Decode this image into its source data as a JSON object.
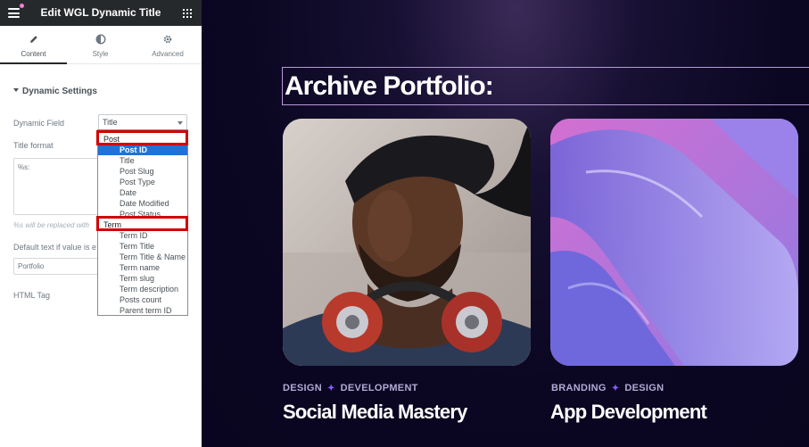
{
  "header": {
    "title": "Edit WGL Dynamic Title"
  },
  "tabs": [
    {
      "label": "Content",
      "icon": "pencil-icon",
      "active": true
    },
    {
      "label": "Style",
      "icon": "contrast-icon",
      "active": false
    },
    {
      "label": "Advanced",
      "icon": "gear-icon",
      "active": false
    }
  ],
  "section": {
    "title": "Dynamic Settings"
  },
  "controls": {
    "dynamic_field_label": "Dynamic Field",
    "dynamic_field_value": "Title",
    "title_format_label": "Title format",
    "title_format_value": "%s:",
    "hint": "%s will be replaced with",
    "default_text_label": "Default text if value is e",
    "default_text_value": "Portfolio",
    "html_tag_label": "HTML Tag"
  },
  "dropdown": {
    "groups": [
      {
        "label": "Post",
        "options": [
          "Post ID",
          "Title",
          "Post Slug",
          "Post Type",
          "Date",
          "Date Modified",
          "Post Status"
        ]
      },
      {
        "label": "Term",
        "options": [
          "Term ID",
          "Term Title",
          "Term Title & Name",
          "Term name",
          "Term slug",
          "Term description",
          "Posts count",
          "Parent term ID"
        ]
      }
    ],
    "selected": "Post ID"
  },
  "preview": {
    "heading": "Archive Portfolio:",
    "cards": [
      {
        "categories": [
          "DESIGN",
          "DEVELOPMENT"
        ],
        "title": "Social Media Mastery"
      },
      {
        "categories": [
          "BRANDING",
          "DESIGN"
        ],
        "title": "App Development"
      }
    ]
  },
  "colors": {
    "panel_header": "#26292c",
    "highlight": "#d00000",
    "selected_option": "#1f73d6",
    "preview_bg": "#0b0722",
    "category_spark": "#8a5cff"
  }
}
